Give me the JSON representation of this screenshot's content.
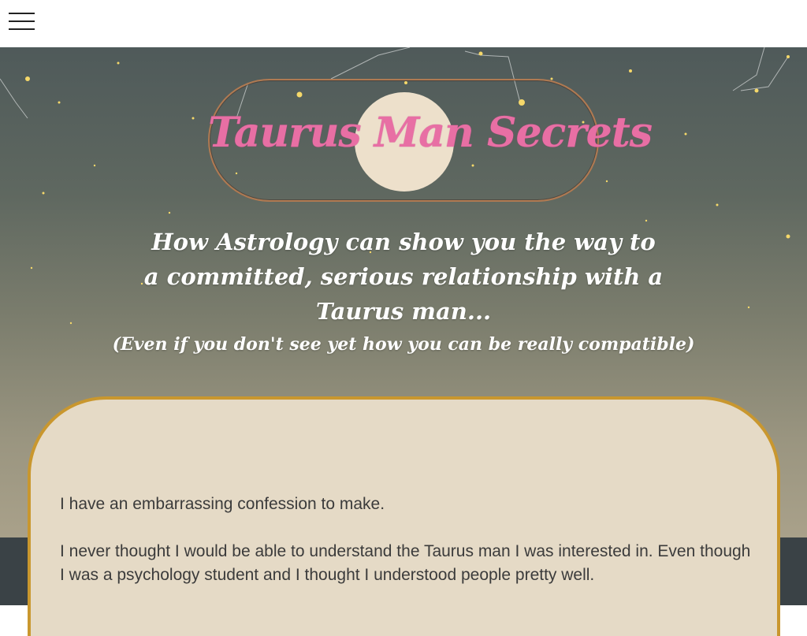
{
  "nav": {
    "menu_icon": "hamburger-menu-icon"
  },
  "logo": {
    "text": "Taurus Man Secrets"
  },
  "hero": {
    "headline_lines": [
      "How Astrology can show you the way to",
      "a committed, serious relationship with a",
      "Taurus man..."
    ],
    "subheadline": "(Even if you don't see yet how you can be really compatible)"
  },
  "content": {
    "paragraphs": [
      "I have an embarrassing confession to make.",
      "I never thought I would be able to understand the Taurus man I was interested in. Even though I was a psychology student and I thought I understood people pretty well."
    ]
  },
  "colors": {
    "card_background": "#e5dac6",
    "card_border": "#c9972e",
    "logo_text": "#e86fa4",
    "footer_band": "#3a4246"
  }
}
